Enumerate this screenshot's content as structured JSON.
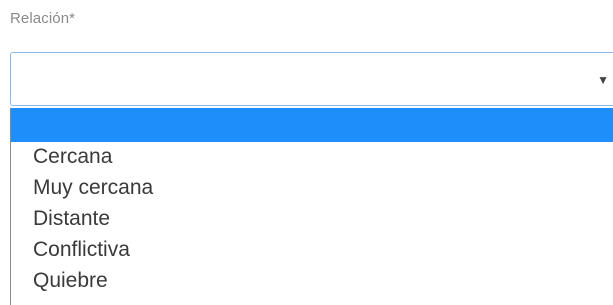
{
  "field": {
    "label": "Relación*",
    "selected_value": "",
    "dropdown_icon": "triangle-down",
    "colors": {
      "focus_border": "#8fb8ea",
      "highlight": "#1e8ffa"
    }
  },
  "options": [
    {
      "label": ""
    },
    {
      "label": "Cercana"
    },
    {
      "label": "Muy cercana"
    },
    {
      "label": "Distante"
    },
    {
      "label": "Conflictiva"
    },
    {
      "label": "Quiebre"
    }
  ]
}
